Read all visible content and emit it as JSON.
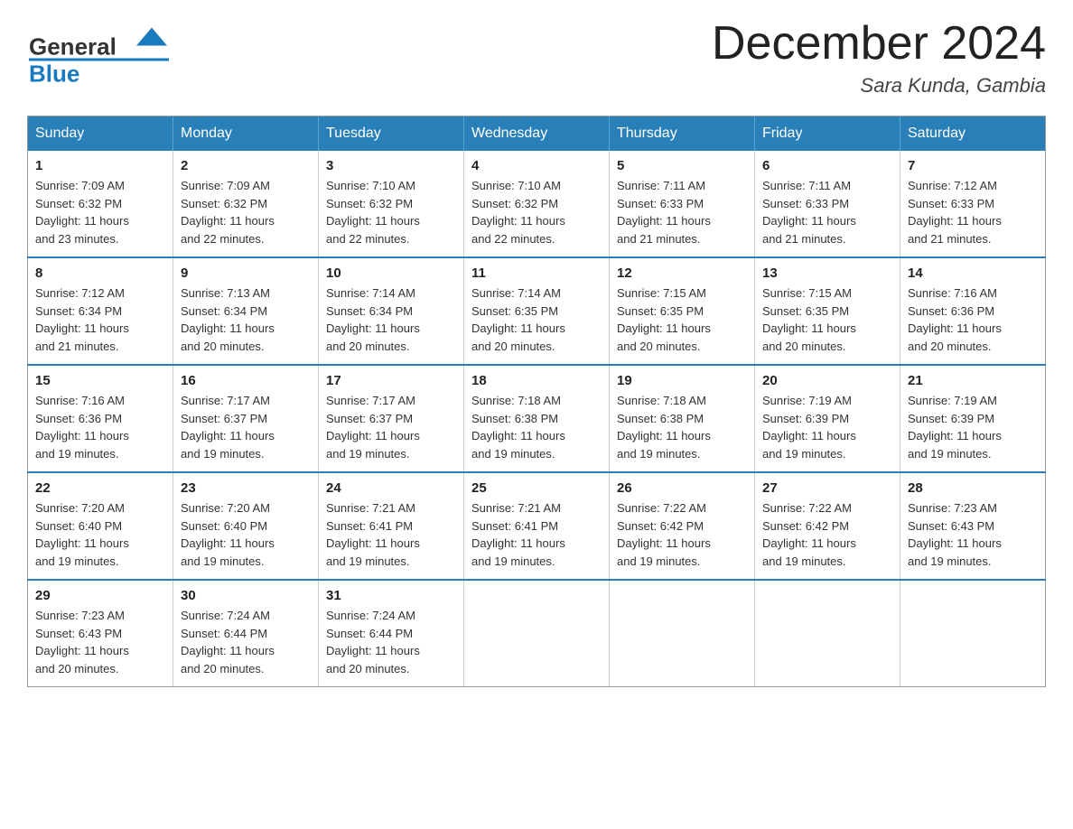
{
  "header": {
    "logo_general": "General",
    "logo_blue": "Blue",
    "title": "December 2024",
    "location": "Sara Kunda, Gambia"
  },
  "days_of_week": [
    "Sunday",
    "Monday",
    "Tuesday",
    "Wednesday",
    "Thursday",
    "Friday",
    "Saturday"
  ],
  "weeks": [
    [
      {
        "day": "1",
        "sunrise": "7:09 AM",
        "sunset": "6:32 PM",
        "daylight": "11 hours and 23 minutes."
      },
      {
        "day": "2",
        "sunrise": "7:09 AM",
        "sunset": "6:32 PM",
        "daylight": "11 hours and 22 minutes."
      },
      {
        "day": "3",
        "sunrise": "7:10 AM",
        "sunset": "6:32 PM",
        "daylight": "11 hours and 22 minutes."
      },
      {
        "day": "4",
        "sunrise": "7:10 AM",
        "sunset": "6:32 PM",
        "daylight": "11 hours and 22 minutes."
      },
      {
        "day": "5",
        "sunrise": "7:11 AM",
        "sunset": "6:33 PM",
        "daylight": "11 hours and 21 minutes."
      },
      {
        "day": "6",
        "sunrise": "7:11 AM",
        "sunset": "6:33 PM",
        "daylight": "11 hours and 21 minutes."
      },
      {
        "day": "7",
        "sunrise": "7:12 AM",
        "sunset": "6:33 PM",
        "daylight": "11 hours and 21 minutes."
      }
    ],
    [
      {
        "day": "8",
        "sunrise": "7:12 AM",
        "sunset": "6:34 PM",
        "daylight": "11 hours and 21 minutes."
      },
      {
        "day": "9",
        "sunrise": "7:13 AM",
        "sunset": "6:34 PM",
        "daylight": "11 hours and 20 minutes."
      },
      {
        "day": "10",
        "sunrise": "7:14 AM",
        "sunset": "6:34 PM",
        "daylight": "11 hours and 20 minutes."
      },
      {
        "day": "11",
        "sunrise": "7:14 AM",
        "sunset": "6:35 PM",
        "daylight": "11 hours and 20 minutes."
      },
      {
        "day": "12",
        "sunrise": "7:15 AM",
        "sunset": "6:35 PM",
        "daylight": "11 hours and 20 minutes."
      },
      {
        "day": "13",
        "sunrise": "7:15 AM",
        "sunset": "6:35 PM",
        "daylight": "11 hours and 20 minutes."
      },
      {
        "day": "14",
        "sunrise": "7:16 AM",
        "sunset": "6:36 PM",
        "daylight": "11 hours and 20 minutes."
      }
    ],
    [
      {
        "day": "15",
        "sunrise": "7:16 AM",
        "sunset": "6:36 PM",
        "daylight": "11 hours and 19 minutes."
      },
      {
        "day": "16",
        "sunrise": "7:17 AM",
        "sunset": "6:37 PM",
        "daylight": "11 hours and 19 minutes."
      },
      {
        "day": "17",
        "sunrise": "7:17 AM",
        "sunset": "6:37 PM",
        "daylight": "11 hours and 19 minutes."
      },
      {
        "day": "18",
        "sunrise": "7:18 AM",
        "sunset": "6:38 PM",
        "daylight": "11 hours and 19 minutes."
      },
      {
        "day": "19",
        "sunrise": "7:18 AM",
        "sunset": "6:38 PM",
        "daylight": "11 hours and 19 minutes."
      },
      {
        "day": "20",
        "sunrise": "7:19 AM",
        "sunset": "6:39 PM",
        "daylight": "11 hours and 19 minutes."
      },
      {
        "day": "21",
        "sunrise": "7:19 AM",
        "sunset": "6:39 PM",
        "daylight": "11 hours and 19 minutes."
      }
    ],
    [
      {
        "day": "22",
        "sunrise": "7:20 AM",
        "sunset": "6:40 PM",
        "daylight": "11 hours and 19 minutes."
      },
      {
        "day": "23",
        "sunrise": "7:20 AM",
        "sunset": "6:40 PM",
        "daylight": "11 hours and 19 minutes."
      },
      {
        "day": "24",
        "sunrise": "7:21 AM",
        "sunset": "6:41 PM",
        "daylight": "11 hours and 19 minutes."
      },
      {
        "day": "25",
        "sunrise": "7:21 AM",
        "sunset": "6:41 PM",
        "daylight": "11 hours and 19 minutes."
      },
      {
        "day": "26",
        "sunrise": "7:22 AM",
        "sunset": "6:42 PM",
        "daylight": "11 hours and 19 minutes."
      },
      {
        "day": "27",
        "sunrise": "7:22 AM",
        "sunset": "6:42 PM",
        "daylight": "11 hours and 19 minutes."
      },
      {
        "day": "28",
        "sunrise": "7:23 AM",
        "sunset": "6:43 PM",
        "daylight": "11 hours and 19 minutes."
      }
    ],
    [
      {
        "day": "29",
        "sunrise": "7:23 AM",
        "sunset": "6:43 PM",
        "daylight": "11 hours and 20 minutes."
      },
      {
        "day": "30",
        "sunrise": "7:24 AM",
        "sunset": "6:44 PM",
        "daylight": "11 hours and 20 minutes."
      },
      {
        "day": "31",
        "sunrise": "7:24 AM",
        "sunset": "6:44 PM",
        "daylight": "11 hours and 20 minutes."
      },
      null,
      null,
      null,
      null
    ]
  ],
  "labels": {
    "sunrise": "Sunrise:",
    "sunset": "Sunset:",
    "daylight": "Daylight:"
  },
  "colors": {
    "header_bg": "#2980b9",
    "accent": "#1a7abf"
  }
}
